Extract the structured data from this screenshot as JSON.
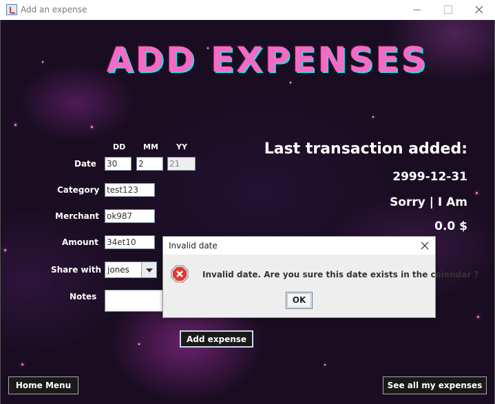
{
  "window": {
    "title": "Add an expense"
  },
  "heading": "ADD EXPENSES",
  "form": {
    "date_headers": {
      "dd": "DD",
      "mm": "MM",
      "yy": "YY"
    },
    "date_label": "Date",
    "dd_value": "30",
    "mm_value": "2",
    "yy_value": "21",
    "category_label": "Category",
    "category_value": "test123",
    "merchant_label": "Merchant",
    "merchant_value": "ok987",
    "amount_label": "Amount",
    "amount_value": "34et10",
    "share_label": "Share with",
    "share_value": "jones",
    "notes_label": "Notes",
    "notes_value": ""
  },
  "last_transaction": {
    "heading": "Last transaction added:",
    "date": "2999-12-31",
    "merchant": "Sorry | I Am",
    "amount": "0.0 $"
  },
  "buttons": {
    "add_expense": "Add expense",
    "home_menu": "Home Menu",
    "see_all": "See all my expenses"
  },
  "dialog": {
    "title": "Invalid date",
    "message": "Invalid date. Are you sure this date exists in the calendar ?",
    "ok_label": "OK",
    "icon": "error-icon"
  },
  "colors": {
    "headline": "#f56bc4",
    "headline_shadow": "#2fd6e0",
    "background": "#1a0d22"
  }
}
